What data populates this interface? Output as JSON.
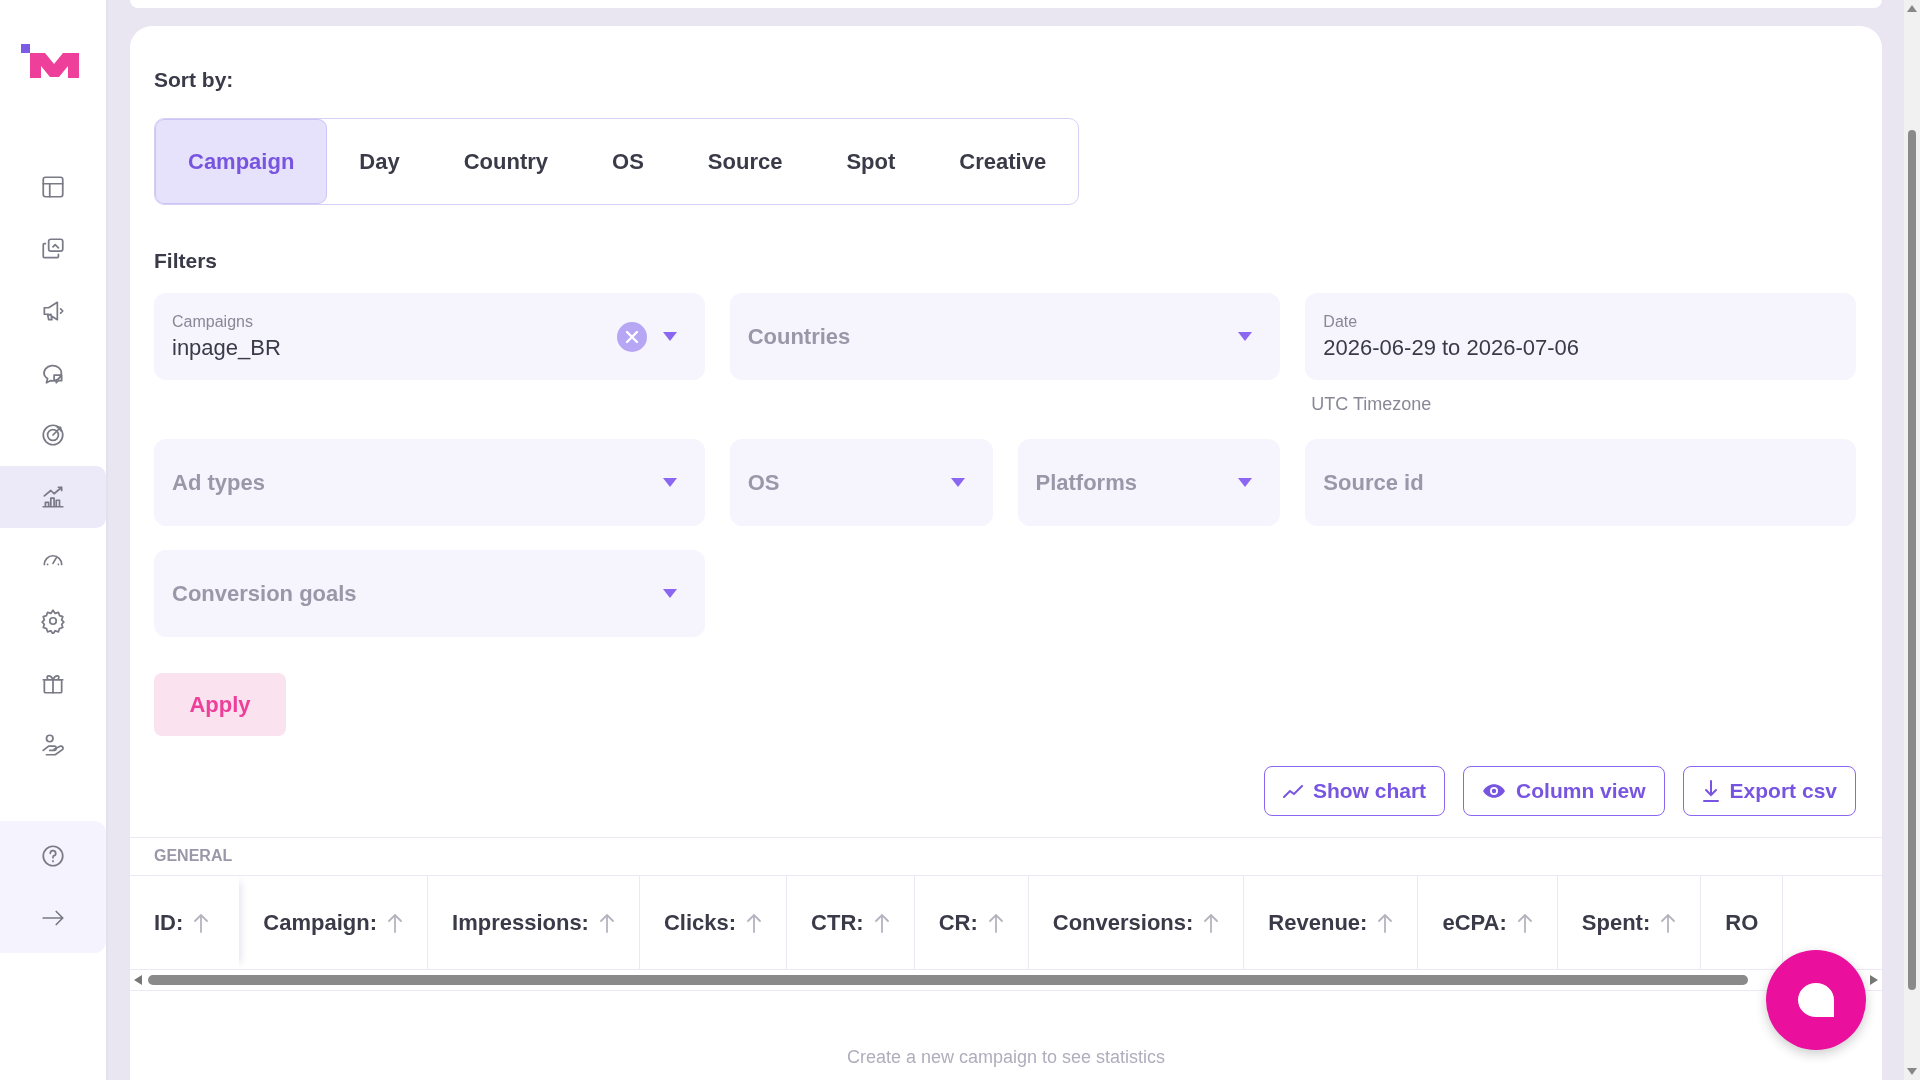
{
  "sidebar": {
    "items": [
      {
        "selected": false
      },
      {
        "selected": false
      },
      {
        "selected": false
      },
      {
        "selected": false
      },
      {
        "selected": false
      },
      {
        "selected": true
      },
      {
        "selected": false
      },
      {
        "selected": false
      },
      {
        "selected": false
      },
      {
        "selected": false
      }
    ]
  },
  "sort": {
    "title": "Sort by:",
    "tabs": [
      {
        "label": "Campaign",
        "selected": true
      },
      {
        "label": "Day",
        "selected": false
      },
      {
        "label": "Country",
        "selected": false
      },
      {
        "label": "OS",
        "selected": false
      },
      {
        "label": "Source",
        "selected": false
      },
      {
        "label": "Spot",
        "selected": false
      },
      {
        "label": "Creative",
        "selected": false
      }
    ]
  },
  "filters": {
    "title": "Filters",
    "fields": [
      {
        "label": "Campaigns",
        "value": "inpage_BR",
        "clearable": true,
        "dropdown": true
      },
      {
        "placeholder": "Countries",
        "clearable": false,
        "dropdown": true
      },
      {
        "label": "Date",
        "value": "2026-06-29 to 2026-07-06",
        "note": "UTC Timezone",
        "clearable": false,
        "dropdown": false
      },
      {
        "placeholder": "Ad types",
        "clearable": false,
        "dropdown": true
      },
      {
        "placeholder": "OS",
        "clearable": false,
        "dropdown": true
      },
      {
        "placeholder": "Platforms",
        "clearable": false,
        "dropdown": true
      },
      {
        "placeholder": "Source id",
        "clearable": false,
        "dropdown": false
      },
      {
        "placeholder": "Conversion goals",
        "clearable": false,
        "dropdown": true
      }
    ],
    "apply": "Apply"
  },
  "actions": [
    {
      "label": "Show chart"
    },
    {
      "label": "Column view"
    },
    {
      "label": "Export csv"
    }
  ],
  "table": {
    "section": "GENERAL",
    "columns": [
      {
        "label": "ID:",
        "sort_icon": true
      },
      {
        "label": "Campaign:",
        "sort_icon": true
      },
      {
        "label": "Impressions:",
        "sort_icon": true
      },
      {
        "label": "Clicks:",
        "sort_icon": true
      },
      {
        "label": "CTR:",
        "sort_icon": true
      },
      {
        "label": "CR:",
        "sort_icon": true
      },
      {
        "label": "Conversions:",
        "sort_icon": true
      },
      {
        "label": "Revenue:",
        "sort_icon": true
      },
      {
        "label": "eCPA:",
        "sort_icon": true
      },
      {
        "label": "Spent:",
        "sort_icon": true
      },
      {
        "label": "RO",
        "sort_icon": false
      }
    ],
    "empty_message": "Create a new campaign to see statistics"
  }
}
